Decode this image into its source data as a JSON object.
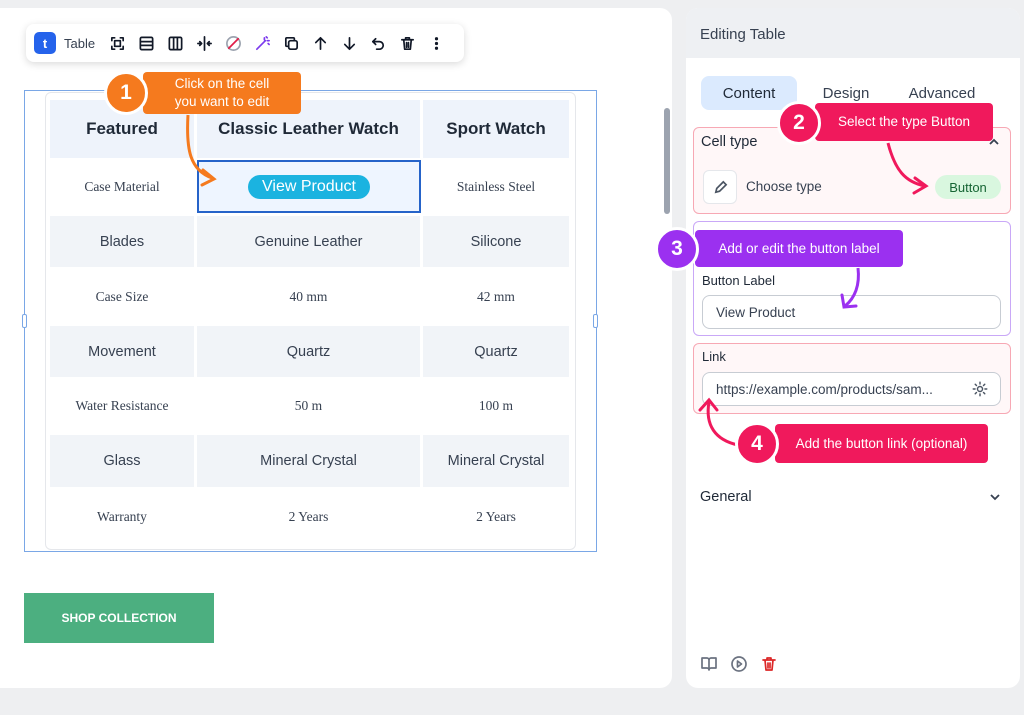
{
  "toolbar": {
    "logo_glyph": "t",
    "label": "Table",
    "icons": [
      "select-cell-icon",
      "rows-icon",
      "columns-icon",
      "split-icon",
      "no-color-icon",
      "magic-icon",
      "duplicate-icon",
      "arrow-up-icon",
      "arrow-down-icon",
      "undo-icon",
      "trash-icon",
      "more-icon"
    ]
  },
  "table": {
    "headers": [
      "Featured",
      "Classic Leather Watch",
      "Sport Watch"
    ],
    "rows": [
      [
        "Case Material",
        "View Product",
        "Stainless Steel"
      ],
      [
        "Blades",
        "Genuine Leather",
        "Silicone"
      ],
      [
        "Case Size",
        "40 mm",
        "42 mm"
      ],
      [
        "Movement",
        "Quartz",
        "Quartz"
      ],
      [
        "Water Resistance",
        "50 m",
        "100 m"
      ],
      [
        "Glass",
        "Mineral Crystal",
        "Mineral Crystal"
      ],
      [
        "Warranty",
        "2 Years",
        "2 Years"
      ]
    ]
  },
  "canvas": {
    "shop_button": "SHOP COLLECTION"
  },
  "panel": {
    "title": "Editing Table",
    "tabs": [
      "Content",
      "Design",
      "Advanced"
    ],
    "cell_type": {
      "title": "Cell type",
      "choose_label": "Choose type",
      "selected": "Button"
    },
    "button_label": {
      "label": "Button Label",
      "value": "View Product"
    },
    "link": {
      "label": "Link",
      "value": "https://example.com/products/sam..."
    },
    "general": "General"
  },
  "callouts": {
    "c1": {
      "number": "1",
      "text_line1": "Click on the cell",
      "text_line2": "you want to edit"
    },
    "c2": {
      "number": "2",
      "text": "Select the type Button"
    },
    "c3": {
      "number": "3",
      "text": "Add or edit the button label"
    },
    "c4": {
      "number": "4",
      "text": "Add the button link (optional)"
    }
  },
  "colors": {
    "accent_blue": "#2563eb",
    "cell_button": "#1bb3e0",
    "shop_green": "#4caf80",
    "callout_orange": "#f57a1e",
    "callout_pink": "#f0195c",
    "callout_purple": "#9b30f0"
  }
}
